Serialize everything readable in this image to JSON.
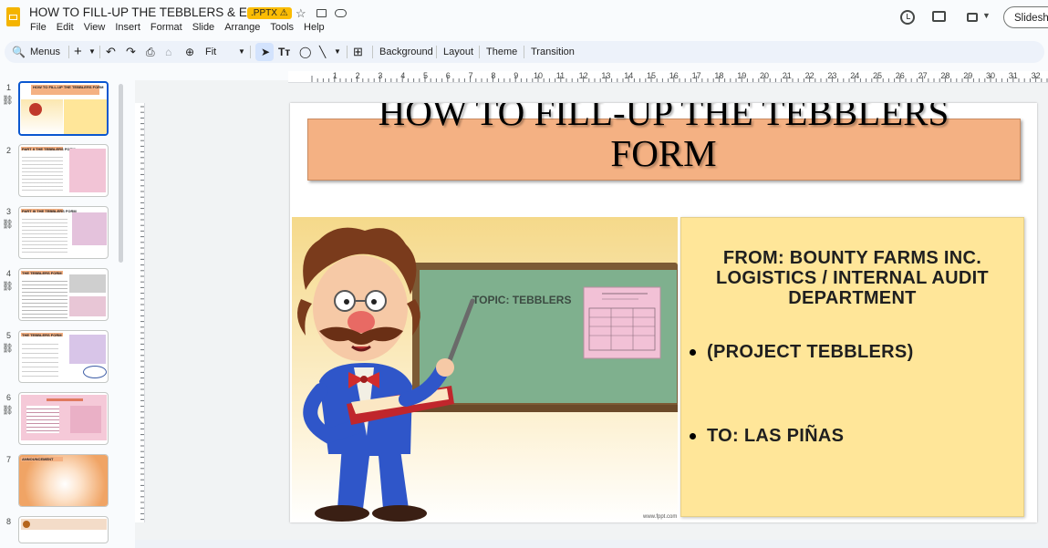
{
  "header": {
    "title": "HOW TO FILL-UP THE TEBBLERS & EBOPOS",
    "badge": ".PPTX",
    "slideshow_label": "Slideshow"
  },
  "menu": [
    "File",
    "Edit",
    "View",
    "Insert",
    "Format",
    "Slide",
    "Arrange",
    "Tools",
    "Help"
  ],
  "toolbar": {
    "menus_label": "Menus",
    "zoom_label": "Fit",
    "background_label": "Background",
    "layout_label": "Layout",
    "theme_label": "Theme",
    "transition_label": "Transition"
  },
  "ruler": [
    "1",
    "2",
    "3",
    "4",
    "5",
    "6",
    "7",
    "8",
    "9",
    "10",
    "11",
    "12",
    "13",
    "14",
    "15",
    "16",
    "17",
    "18",
    "19",
    "20",
    "21",
    "22",
    "23",
    "24",
    "25",
    "26",
    "27",
    "28",
    "29",
    "30",
    "31",
    "32",
    "33"
  ],
  "filmstrip": {
    "slides": [
      {
        "num": "1",
        "title": "HOW TO FILL-UP THE TEBBLERS FORM",
        "linked": true
      },
      {
        "num": "2",
        "title": "PART II THE TEBBLERS FORM",
        "linked": false
      },
      {
        "num": "3",
        "title": "PART III THE TEBBLERS FORM",
        "linked": true
      },
      {
        "num": "4",
        "title": "THE TEBBLERS FORM",
        "linked": true
      },
      {
        "num": "5",
        "title": "THE TEBBLERS FORM",
        "linked": true
      },
      {
        "num": "6",
        "title": "",
        "linked": true
      },
      {
        "num": "7",
        "title": "ANNOUNCEMENT",
        "linked": false
      },
      {
        "num": "8",
        "title": "",
        "linked": false
      }
    ]
  },
  "slide": {
    "title_line1": "HOW TO FILL-UP THE TEBBLERS",
    "title_line2": "FORM",
    "from_line1": "FROM: BOUNTY FARMS INC.",
    "from_line2": "LOGISTICS / INTERNAL AUDIT",
    "from_line3": "DEPARTMENT",
    "bullet1": "(PROJECT TEBBLERS)",
    "bullet2": "TO: LAS PIÑAS",
    "topic_text": "TOPIC:   TEBBLERS",
    "website": "www.fppt.com"
  },
  "colors": {
    "title_box": "#f4b183",
    "info_box": "#ffe699",
    "board": "#7fb08e",
    "accent": "#0b57d0"
  }
}
